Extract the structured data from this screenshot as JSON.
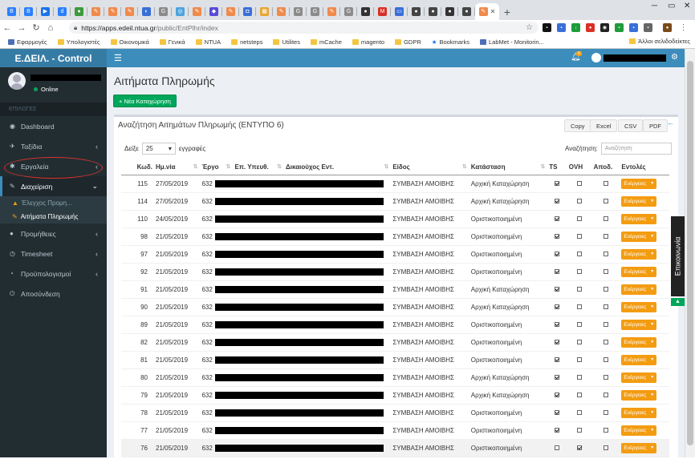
{
  "browser": {
    "tabs": [
      {
        "icon": "doc-icon",
        "color": "#2a7fff",
        "glyph": "B"
      },
      {
        "icon": "doc-icon",
        "color": "#2a7fff",
        "glyph": "B"
      },
      {
        "icon": "flag-icon",
        "color": "#1a73e8",
        "glyph": "▶"
      },
      {
        "icon": "doc-icon",
        "color": "#2a7fff",
        "glyph": "d"
      },
      {
        "icon": "leaf-icon",
        "color": "#3c9a3c",
        "glyph": "●"
      },
      {
        "icon": "pen-icon",
        "color": "#f08a4b",
        "glyph": "✎"
      },
      {
        "icon": "pen-icon",
        "color": "#f08a4b",
        "glyph": "✎"
      },
      {
        "icon": "pen-icon",
        "color": "#f08a4b",
        "glyph": "✎"
      },
      {
        "icon": "globe-icon",
        "color": "#3a6fd8",
        "glyph": "◐"
      },
      {
        "icon": "google-icon",
        "color": "#8a8a8a",
        "glyph": "G"
      },
      {
        "icon": "circle-icon",
        "color": "#4aa3df",
        "glyph": "◎"
      },
      {
        "icon": "pen-icon",
        "color": "#f08a4b",
        "glyph": "✎"
      },
      {
        "icon": "cube-icon",
        "color": "#5a4ad8",
        "glyph": "◆"
      },
      {
        "icon": "pen-icon",
        "color": "#f08a4b",
        "glyph": "✎"
      },
      {
        "icon": "shield-icon",
        "color": "#3a6fd8",
        "glyph": "◘"
      },
      {
        "icon": "windows-icon",
        "color": "#e8a530",
        "glyph": "▦"
      },
      {
        "icon": "pen-icon",
        "color": "#f08a4b",
        "glyph": "✎"
      },
      {
        "icon": "google-icon",
        "color": "#8a8a8a",
        "glyph": "G"
      },
      {
        "icon": "google-icon",
        "color": "#8a8a8a",
        "glyph": "G"
      },
      {
        "icon": "pen-icon",
        "color": "#f08a4b",
        "glyph": "✎"
      },
      {
        "icon": "google-icon",
        "color": "#8a8a8a",
        "glyph": "G"
      },
      {
        "icon": "github-icon",
        "color": "#333333",
        "glyph": "●"
      },
      {
        "icon": "mail-icon",
        "color": "#d93025",
        "glyph": "M"
      },
      {
        "icon": "monitor-icon",
        "color": "#3a6fd8",
        "glyph": "▭"
      },
      {
        "icon": "bug-icon",
        "color": "#444444",
        "glyph": "●"
      },
      {
        "icon": "bug-icon",
        "color": "#444444",
        "glyph": "●"
      },
      {
        "icon": "github-icon",
        "color": "#333333",
        "glyph": "●"
      },
      {
        "icon": "bug-icon",
        "color": "#444444",
        "glyph": "●"
      }
    ],
    "active_tab_icon": "pen-icon",
    "url_host": "https://apps.edeil.ntua.gr",
    "url_path": "/public/EntPlhr/index",
    "bookmarks": [
      {
        "label": "Εφαρμογές",
        "icon": "apps-icon",
        "kind": "grid"
      },
      {
        "label": "Υπολογιστές",
        "icon": "folder-icon",
        "kind": "folder"
      },
      {
        "label": "Οικονομικά",
        "icon": "folder-icon",
        "kind": "folder"
      },
      {
        "label": "Γενικά",
        "icon": "folder-icon",
        "kind": "folder"
      },
      {
        "label": "NTUA",
        "icon": "folder-icon",
        "kind": "folder"
      },
      {
        "label": "netsteps",
        "icon": "folder-icon",
        "kind": "folder"
      },
      {
        "label": "Utilites",
        "icon": "folder-icon",
        "kind": "folder"
      },
      {
        "label": "mCache",
        "icon": "folder-icon",
        "kind": "folder"
      },
      {
        "label": "magento",
        "icon": "folder-icon",
        "kind": "folder"
      },
      {
        "label": "GDPR",
        "icon": "folder-icon",
        "kind": "folder"
      },
      {
        "label": "Bookmarks",
        "icon": "star-icon",
        "kind": "star"
      },
      {
        "label": "LabMet - Monitorin...",
        "icon": "bookmark-icon",
        "kind": "grid"
      }
    ],
    "other_bookmarks": "Άλλοι σελιδοδείκτες"
  },
  "app": {
    "brand": "Ε.ΔΕΙΛ. - Control",
    "status": "Online",
    "section_header": "ΕΠΙΛΟΓΕΣ",
    "notif_count": "6",
    "menu": [
      {
        "label": "Dashboard",
        "icon": "dashboard-icon",
        "glyph": "◉",
        "chev": ""
      },
      {
        "label": "Ταξίδια",
        "icon": "plane-icon",
        "glyph": "✈",
        "chev": "‹"
      },
      {
        "label": "Εργαλεία",
        "icon": "tools-icon",
        "glyph": "✱",
        "chev": "‹"
      }
    ],
    "menu_open": {
      "label": "Διαχείριση",
      "icon": "wrench-icon",
      "glyph": "✎",
      "chev": "⌄"
    },
    "submenu": [
      {
        "label": "Έλεγχος Προμη...",
        "icon": "warning-icon",
        "glyph": "▲"
      },
      {
        "label": "Αιτήματα Πληρωμής",
        "icon": "payment-icon",
        "glyph": "✎"
      }
    ],
    "menu_after": [
      {
        "label": "Προμήθειες",
        "icon": "tag-icon",
        "glyph": "●",
        "chev": "‹"
      },
      {
        "label": "Timesheet",
        "icon": "clock-icon",
        "glyph": "◷",
        "chev": "‹"
      },
      {
        "label": "Προϋπολογισμοί",
        "icon": "budget-icon",
        "glyph": "◔",
        "chev": "‹"
      },
      {
        "label": "Αποσύνδεση",
        "icon": "power-icon",
        "glyph": "⏻",
        "chev": ""
      }
    ]
  },
  "page": {
    "title": "Αιτήματα Πληρωμής",
    "new_button": "+ Νέα Καταχώρηση",
    "box_title": "Αναζήτηση Αιτημάτων Πληρωμής (ΕΝΤΥΠΟ 6)",
    "export": [
      "Copy",
      "Excel",
      "CSV",
      "PDF"
    ],
    "show_prefix": "Δείξε",
    "show_value": "25",
    "show_suffix": "εγγραφές",
    "search_label": "Αναζήτηση:",
    "search_placeholder": "Αναζήτηση",
    "side_tab": "Επικοινωνία",
    "columns": [
      "Κωδ.",
      "Ημ.νία",
      "Έργο",
      "Επ. Υπευθ.",
      "Δικαιούχος Εντ.",
      "Είδος",
      "Κατάσταση",
      "TS",
      "OVH",
      "Αποδ.",
      "Εντολές"
    ]
  },
  "rows": [
    {
      "id": "115",
      "date": "27/05/2019",
      "proj": "632",
      "type": "ΣΥΜΒΑΣΗ ΑΜΟΙΒΗΣ",
      "status": "Αρχική Καταχώρηση",
      "ts": true,
      "ovh": false,
      "apod": false,
      "action": "Ενέργειες"
    },
    {
      "id": "114",
      "date": "27/05/2019",
      "proj": "632",
      "type": "ΣΥΜΒΑΣΗ ΑΜΟΙΒΗΣ",
      "status": "Αρχική Καταχώρηση",
      "ts": true,
      "ovh": false,
      "apod": false,
      "action": "Ενέργειες"
    },
    {
      "id": "110",
      "date": "24/05/2019",
      "proj": "632",
      "type": "ΣΥΜΒΑΣΗ ΑΜΟΙΒΗΣ",
      "status": "Οριστικοποιημένη",
      "ts": true,
      "ovh": false,
      "apod": false,
      "action": "Ενέργειες"
    },
    {
      "id": "98",
      "date": "21/05/2019",
      "proj": "632",
      "type": "ΣΥΜΒΑΣΗ ΑΜΟΙΒΗΣ",
      "status": "Οριστικοποιημένη",
      "ts": true,
      "ovh": false,
      "apod": false,
      "action": "Ενέργειες"
    },
    {
      "id": "97",
      "date": "21/05/2019",
      "proj": "632",
      "type": "ΣΥΜΒΑΣΗ ΑΜΟΙΒΗΣ",
      "status": "Οριστικοποιημένη",
      "ts": true,
      "ovh": false,
      "apod": false,
      "action": "Ενέργειες"
    },
    {
      "id": "92",
      "date": "21/05/2019",
      "proj": "632",
      "type": "ΣΥΜΒΑΣΗ ΑΜΟΙΒΗΣ",
      "status": "Οριστικοποιημένη",
      "ts": true,
      "ovh": false,
      "apod": false,
      "action": "Ενέργειες"
    },
    {
      "id": "91",
      "date": "21/05/2019",
      "proj": "632",
      "type": "ΣΥΜΒΑΣΗ ΑΜΟΙΒΗΣ",
      "status": "Αρχική Καταχώρηση",
      "ts": true,
      "ovh": false,
      "apod": false,
      "action": "Ενέργειες"
    },
    {
      "id": "90",
      "date": "21/05/2019",
      "proj": "632",
      "type": "ΣΥΜΒΑΣΗ ΑΜΟΙΒΗΣ",
      "status": "Αρχική Καταχώρηση",
      "ts": true,
      "ovh": false,
      "apod": false,
      "action": "Ενέργειες"
    },
    {
      "id": "89",
      "date": "21/05/2019",
      "proj": "632",
      "type": "ΣΥΜΒΑΣΗ ΑΜΟΙΒΗΣ",
      "status": "Οριστικοποιημένη",
      "ts": true,
      "ovh": false,
      "apod": false,
      "action": "Ενέργειες"
    },
    {
      "id": "82",
      "date": "21/05/2019",
      "proj": "632",
      "type": "ΣΥΜΒΑΣΗ ΑΜΟΙΒΗΣ",
      "status": "Οριστικοποιημένη",
      "ts": true,
      "ovh": false,
      "apod": false,
      "action": "Ενέργειες"
    },
    {
      "id": "81",
      "date": "21/05/2019",
      "proj": "632",
      "type": "ΣΥΜΒΑΣΗ ΑΜΟΙΒΗΣ",
      "status": "Οριστικοποιημένη",
      "ts": true,
      "ovh": false,
      "apod": false,
      "action": "Ενέργειες"
    },
    {
      "id": "80",
      "date": "21/05/2019",
      "proj": "632",
      "type": "ΣΥΜΒΑΣΗ ΑΜΟΙΒΗΣ",
      "status": "Αρχική Καταχώρηση",
      "ts": true,
      "ovh": false,
      "apod": false,
      "action": "Ενέργειες"
    },
    {
      "id": "79",
      "date": "21/05/2019",
      "proj": "632",
      "type": "ΣΥΜΒΑΣΗ ΑΜΟΙΒΗΣ",
      "status": "Αρχική Καταχώρηση",
      "ts": true,
      "ovh": false,
      "apod": false,
      "action": "Ενέργειες"
    },
    {
      "id": "78",
      "date": "21/05/2019",
      "proj": "632",
      "type": "ΣΥΜΒΑΣΗ ΑΜΟΙΒΗΣ",
      "status": "Οριστικοποιημένη",
      "ts": true,
      "ovh": false,
      "apod": false,
      "action": "Ενέργειες"
    },
    {
      "id": "77",
      "date": "21/05/2019",
      "proj": "632",
      "type": "ΣΥΜΒΑΣΗ ΑΜΟΙΒΗΣ",
      "status": "Οριστικοποιημένη",
      "ts": true,
      "ovh": false,
      "apod": false,
      "action": "Ενέργειες"
    },
    {
      "id": "76",
      "date": "21/05/2019",
      "proj": "632",
      "type": "ΣΥΜΒΑΣΗ ΑΜΟΙΒΗΣ",
      "status": "Οριστικοποιημένη",
      "ts": false,
      "ovh": true,
      "apod": false,
      "action": "Ενέργειες"
    }
  ]
}
